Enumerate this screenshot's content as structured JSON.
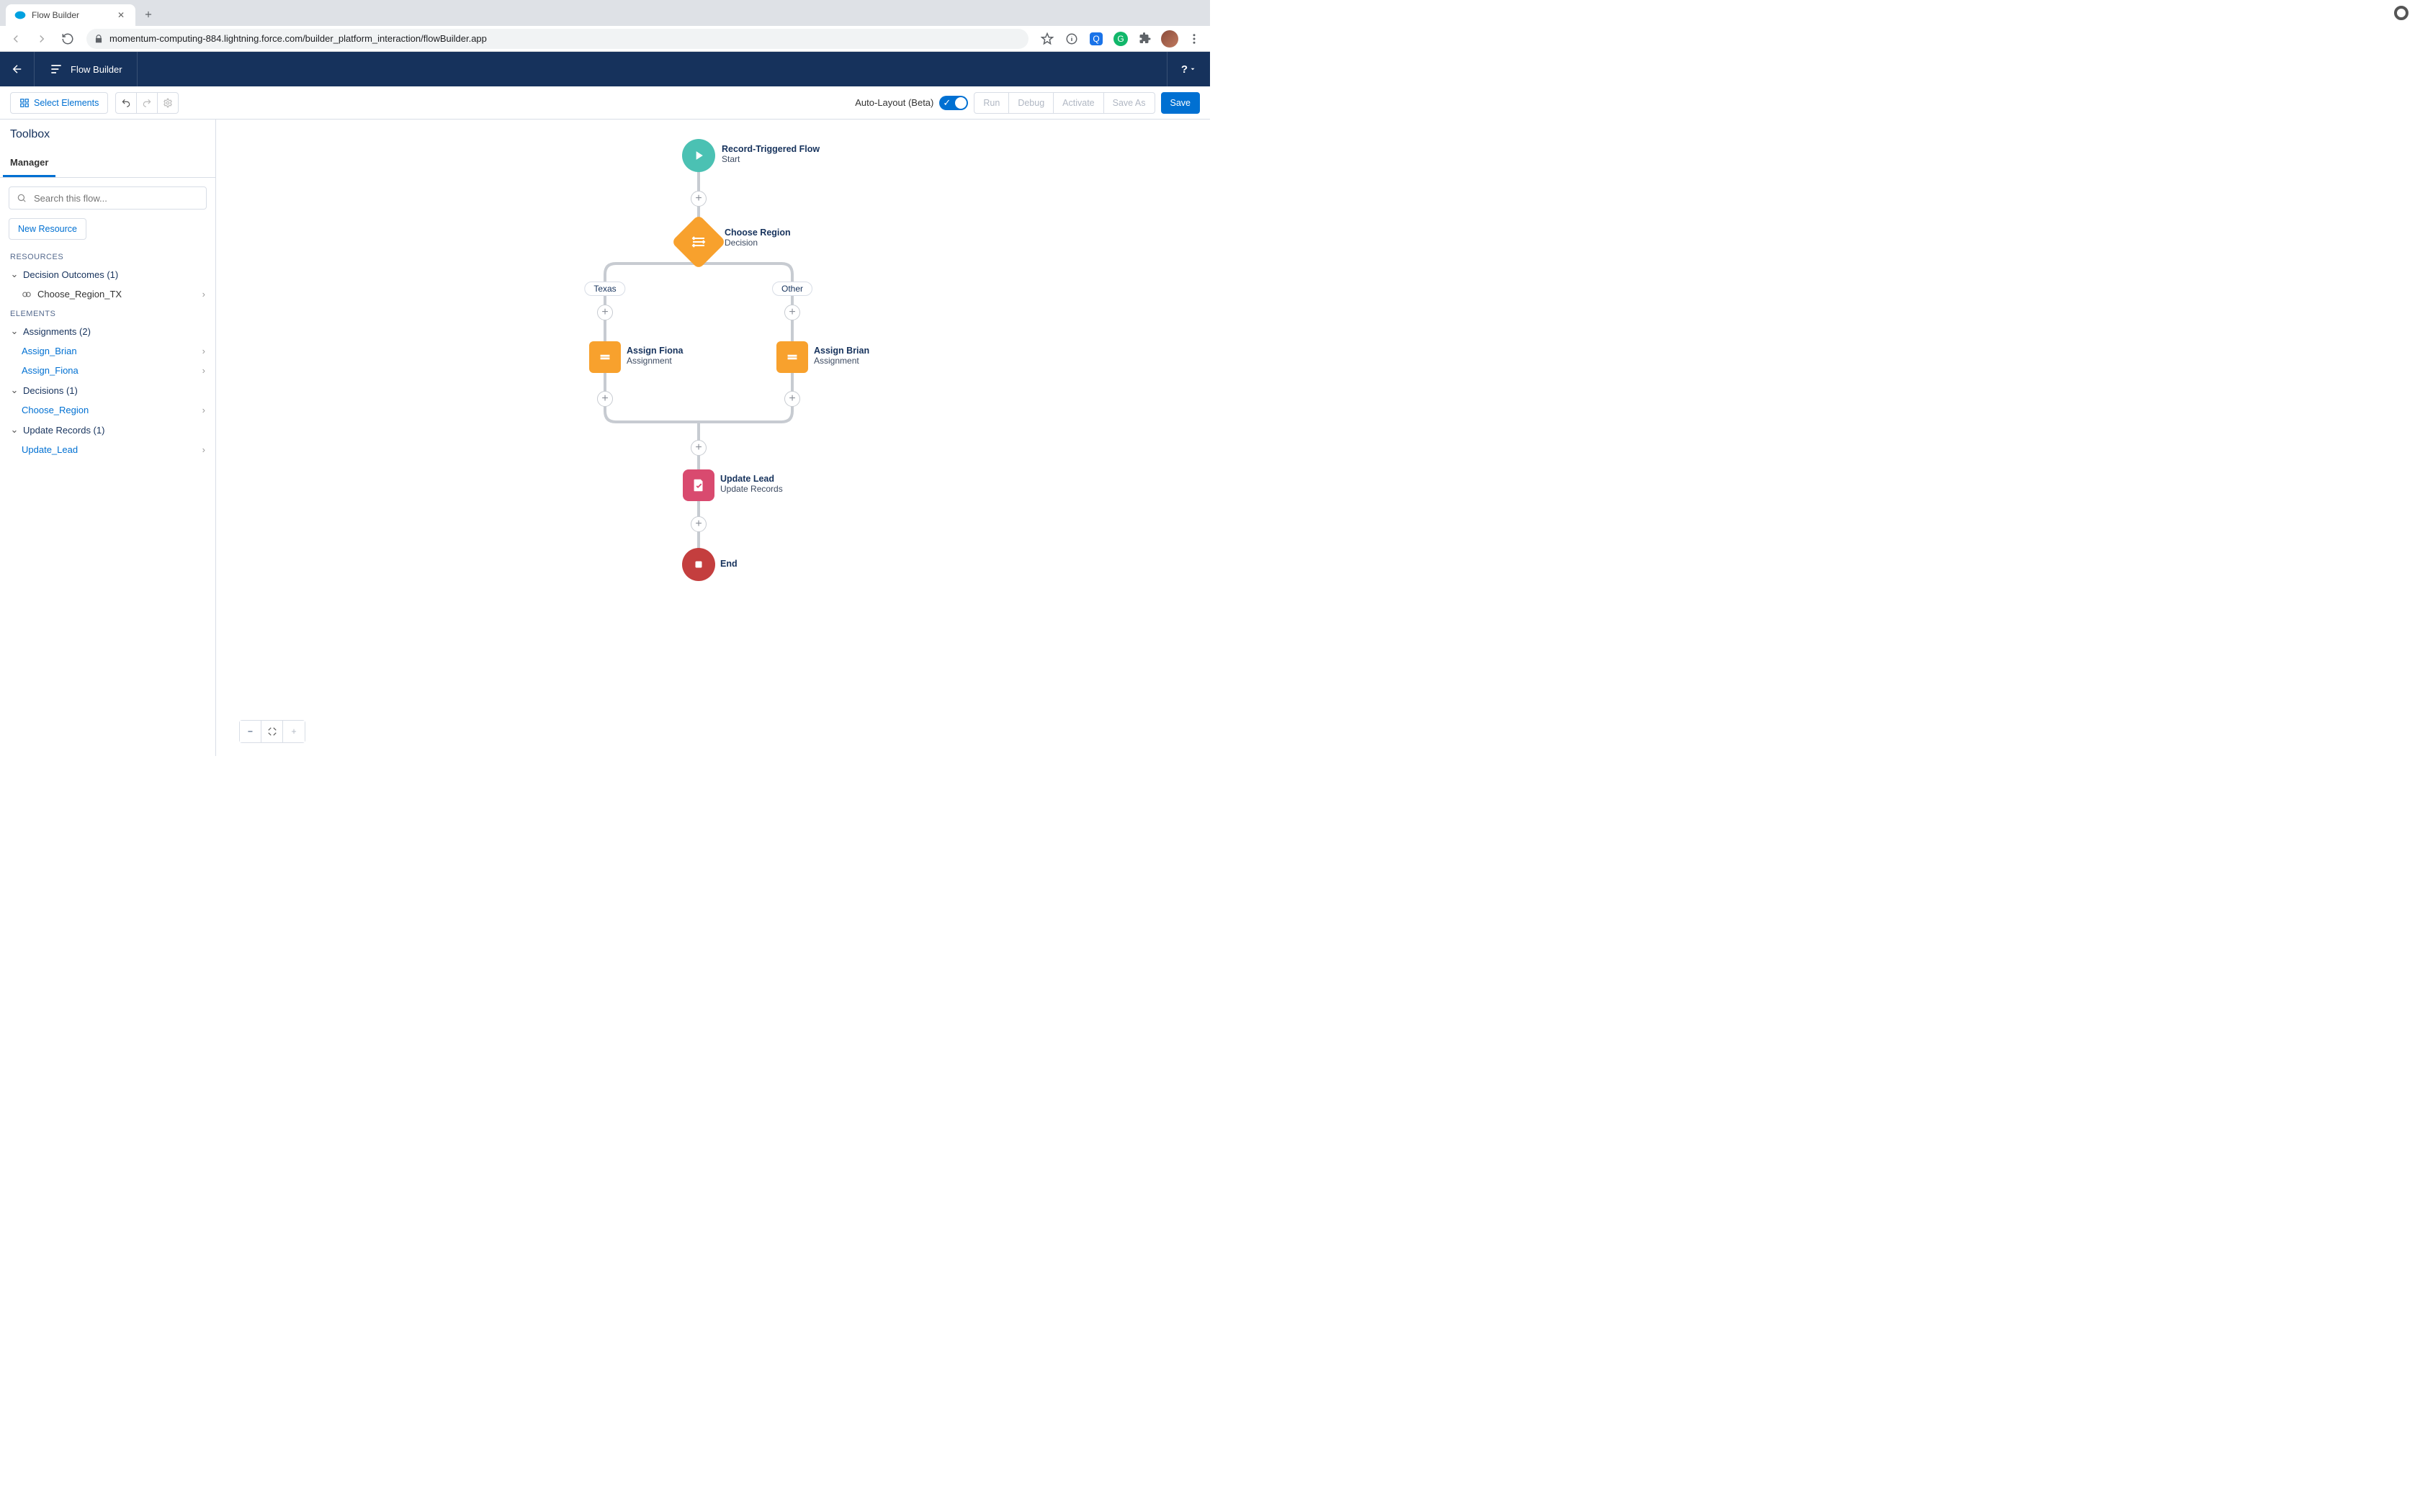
{
  "browser": {
    "tab_title": "Flow Builder",
    "url": "momentum-computing-884.lightning.force.com/builder_platform_interaction/flowBuilder.app"
  },
  "header": {
    "app_title": "Flow Builder"
  },
  "action_bar": {
    "select_elements": "Select Elements",
    "auto_layout_label": "Auto-Layout (Beta)",
    "btn_run": "Run",
    "btn_debug": "Debug",
    "btn_activate": "Activate",
    "btn_save_as": "Save As",
    "btn_save": "Save"
  },
  "sidebar": {
    "title": "Toolbox",
    "tabs": {
      "manager": "Manager"
    },
    "search_placeholder": "Search this flow...",
    "new_resource": "New Resource",
    "labels": {
      "resources": "RESOURCES",
      "elements": "ELEMENTS"
    },
    "groups": {
      "decision_outcomes": "Decision Outcomes (1)",
      "assignments": "Assignments (2)",
      "decisions": "Decisions (1)",
      "update_records": "Update Records (1)"
    },
    "items": {
      "choose_region_tx": "Choose_Region_TX",
      "assign_brian": "Assign_Brian",
      "assign_fiona": "Assign_Fiona",
      "choose_region": "Choose_Region",
      "update_lead": "Update_Lead"
    }
  },
  "canvas": {
    "start": {
      "title": "Record-Triggered Flow",
      "sub": "Start"
    },
    "decision": {
      "title": "Choose Region",
      "sub": "Decision"
    },
    "branches": {
      "left": "Texas",
      "right": "Other"
    },
    "assign_left": {
      "title": "Assign Fiona",
      "sub": "Assignment"
    },
    "assign_right": {
      "title": "Assign Brian",
      "sub": "Assignment"
    },
    "update": {
      "title": "Update Lead",
      "sub": "Update Records"
    },
    "end": {
      "title": "End"
    }
  },
  "chart_data": {
    "type": "flow",
    "nodes": [
      {
        "id": "start",
        "kind": "trigger",
        "label": "Record-Triggered Flow",
        "sublabel": "Start"
      },
      {
        "id": "choose_region",
        "kind": "decision",
        "label": "Choose Region",
        "sublabel": "Decision"
      },
      {
        "id": "assign_fiona",
        "kind": "assignment",
        "label": "Assign Fiona",
        "sublabel": "Assignment"
      },
      {
        "id": "assign_brian",
        "kind": "assignment",
        "label": "Assign Brian",
        "sublabel": "Assignment"
      },
      {
        "id": "update_lead",
        "kind": "update_records",
        "label": "Update Lead",
        "sublabel": "Update Records"
      },
      {
        "id": "end",
        "kind": "end",
        "label": "End"
      }
    ],
    "edges": [
      {
        "from": "start",
        "to": "choose_region"
      },
      {
        "from": "choose_region",
        "to": "assign_fiona",
        "label": "Texas"
      },
      {
        "from": "choose_region",
        "to": "assign_brian",
        "label": "Other"
      },
      {
        "from": "assign_fiona",
        "to": "update_lead"
      },
      {
        "from": "assign_brian",
        "to": "update_lead"
      },
      {
        "from": "update_lead",
        "to": "end"
      }
    ]
  }
}
